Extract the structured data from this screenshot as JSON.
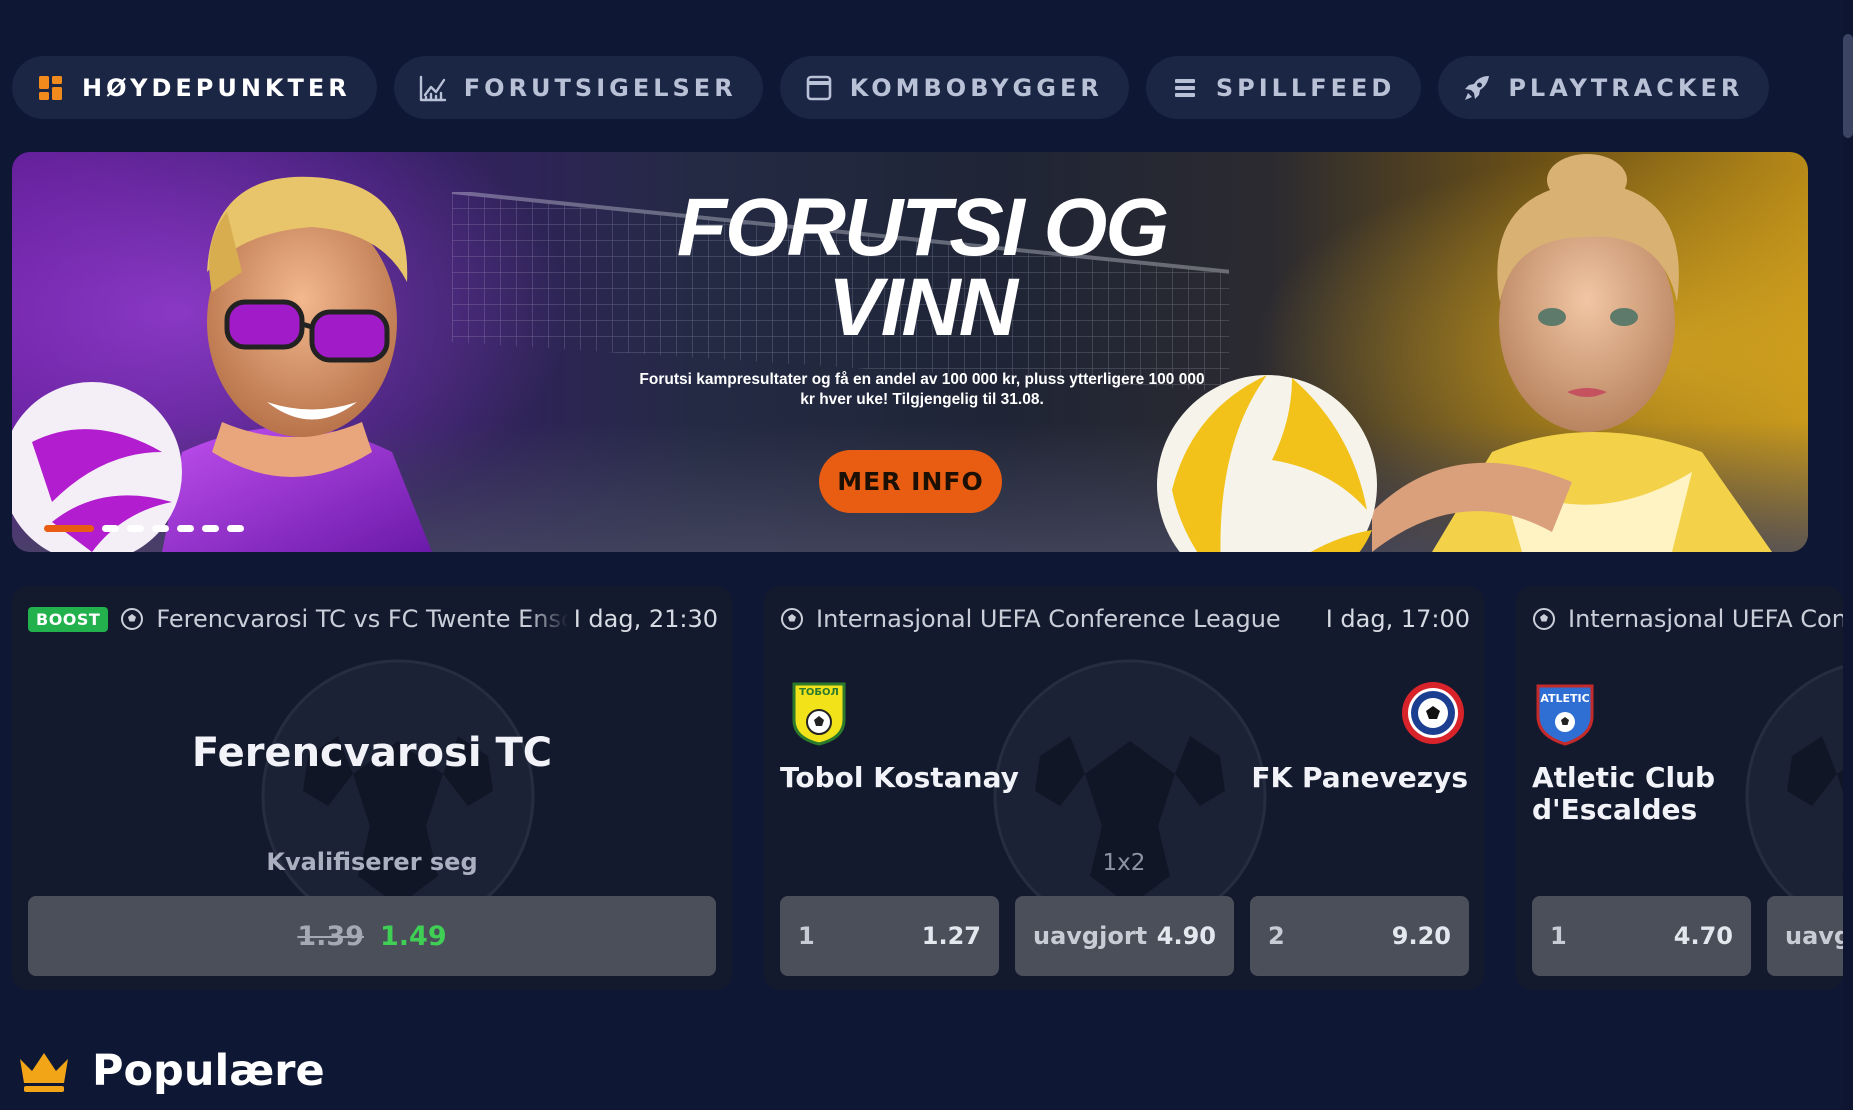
{
  "tabs": [
    {
      "label": "HØYDEPUNKTER",
      "icon": "grid-icon"
    },
    {
      "label": "FORUTSIGELSER",
      "icon": "chart-icon"
    },
    {
      "label": "KOMBOBYGGER",
      "icon": "card-icon"
    },
    {
      "label": "SPILLFEED",
      "icon": "list-icon"
    },
    {
      "label": "PLAYTRACKER",
      "icon": "rocket-icon"
    }
  ],
  "banner": {
    "title_line1": "FORUTSI OG",
    "title_line2": "VINN",
    "subtitle": "Forutsi kampresultater og få en andel av 100 000 kr, pluss ytterligere 100 000 kr hver uke! Tilgjengelig til 31.08.",
    "button": "MER INFO",
    "slides_total": 7,
    "active_slide": 1
  },
  "cards": [
    {
      "badge": "BOOST",
      "title": "Ferencvarosi TC vs FC Twente Enschede",
      "time": "I dag, 21:30",
      "team": "Ferencvarosi TC",
      "market": "Kvalifiserer seg",
      "old_odds": "1.39",
      "new_odds": "1.49"
    },
    {
      "title": "Internasjonal UEFA Conference League",
      "time": "I dag, 17:00",
      "home": "Tobol Kostanay",
      "away": "FK Panevezys",
      "home_logo_text": "ТОБОЛ",
      "market": "1x2",
      "odds": [
        {
          "label": "1",
          "value": "1.27"
        },
        {
          "label": "uavgjort",
          "value": "4.90"
        },
        {
          "label": "2",
          "value": "9.20"
        }
      ]
    },
    {
      "title": "Internasjonal UEFA Conference League",
      "home_line1": "Atletic Club",
      "home_line2": "d'Escaldes",
      "home_logo_text": "ATLETIC",
      "odds": [
        {
          "label": "1",
          "value": "4.70"
        },
        {
          "label": "uavgjort",
          "value": ""
        }
      ]
    }
  ],
  "popular": {
    "title": "Populære",
    "icon": "crown-icon"
  },
  "colors": {
    "background": "#0e1733",
    "tab": "#1b2544",
    "accent": "#e85d12",
    "boost": "#22b14c",
    "odds_button": "#4b4f59",
    "boost_new": "#3fcf55"
  }
}
